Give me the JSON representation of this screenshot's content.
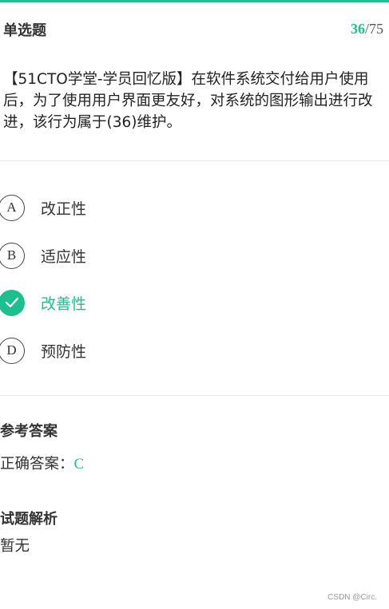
{
  "header": {
    "question_type": "单选题",
    "current": "36",
    "separator": "/",
    "total": "75"
  },
  "question": {
    "stem": "【51CTO学堂-学员回忆版】在软件系统交付给用户使用后，为了使用用户界面更友好，对系统的图形输出进行改进，该行为属于(36)维护。"
  },
  "options": [
    {
      "letter": "A",
      "text": "改正性",
      "selected": false
    },
    {
      "letter": "B",
      "text": "适应性",
      "selected": false
    },
    {
      "letter": "C",
      "text": "改善性",
      "selected": true
    },
    {
      "letter": "D",
      "text": "预防性",
      "selected": false
    }
  ],
  "reference": {
    "title": "参考答案",
    "label": "正确答案：",
    "value": "C"
  },
  "analysis": {
    "title": "试题解析",
    "content": "暂无"
  },
  "watermark": "CSDN @Circ.",
  "colors": {
    "accent": "#1cc08f",
    "text": "#333333",
    "divider": "#e6e6e6"
  }
}
